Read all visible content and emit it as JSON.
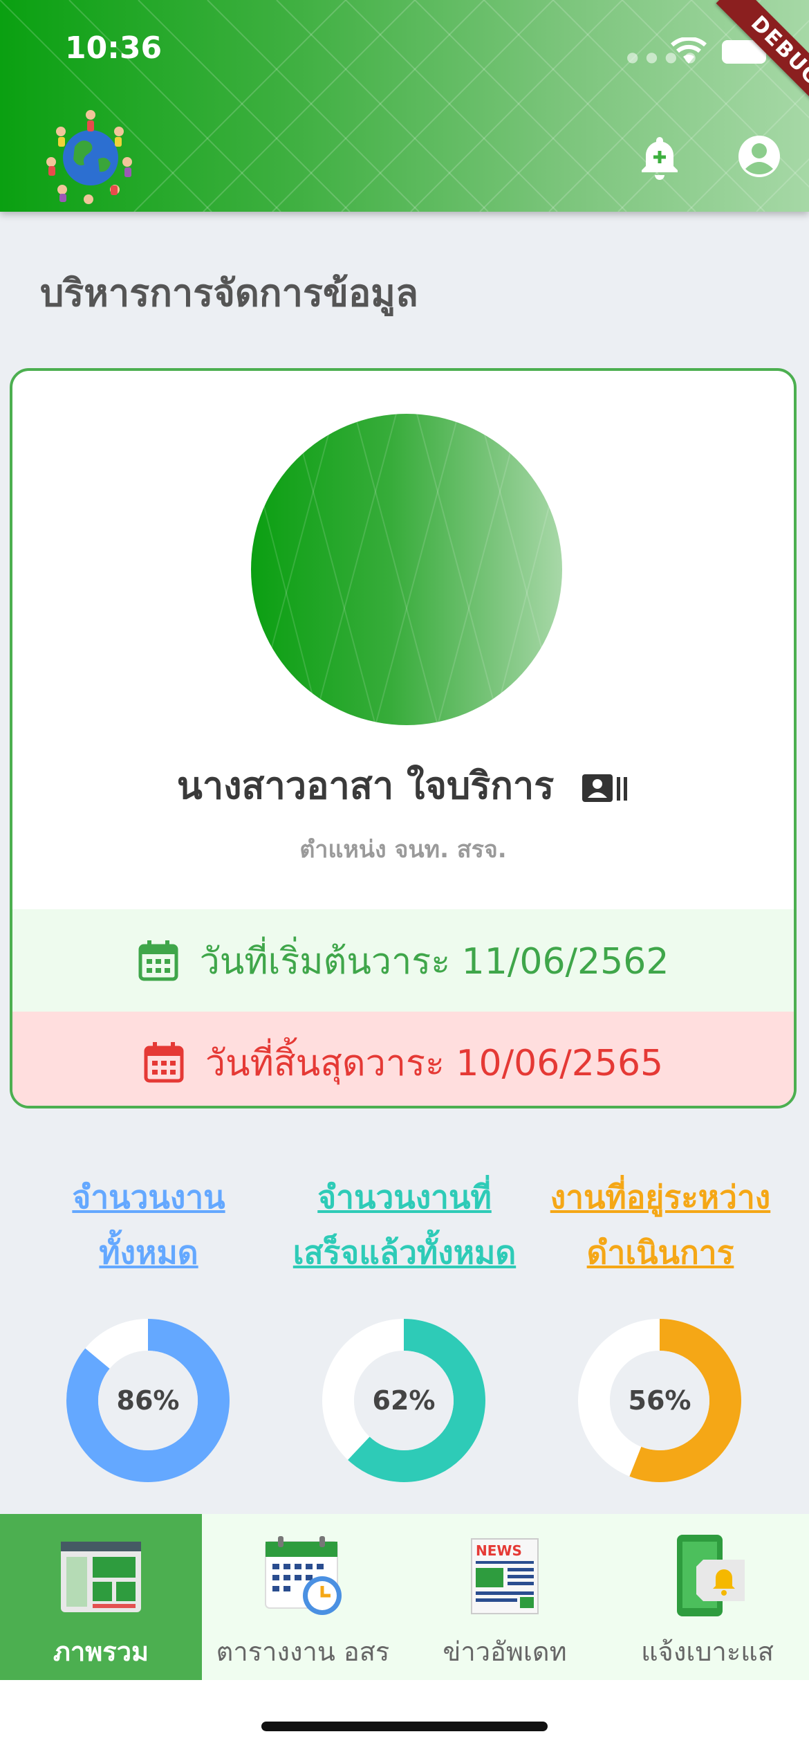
{
  "status_bar": {
    "time": "10:36",
    "debug_label": "DEBUG"
  },
  "header": {
    "logo_icon": "kids-around-globe-logo",
    "notification_icon": "bell-plus-icon",
    "profile_icon": "account-circle-icon",
    "gradient": [
      "#0aa011",
      "#a6d8a6"
    ]
  },
  "page": {
    "title": "บริหารการจัดการข้อมูล"
  },
  "profile": {
    "name": "นางสาวอาสา ใจบริการ",
    "id_icon": "id-card-icon",
    "position": "ตำแหน่ง จนท. สรจ.",
    "term_start": "วันที่เริ่มต้นวาระ 11/06/2562",
    "term_end": "วันที่สิ้นสุดวาระ 10/06/2565",
    "start_color": "#3fa64a",
    "end_color": "#e53935"
  },
  "stats": [
    {
      "label_line1": "จำนวนงาน",
      "label_line2": "ทั้งหมด",
      "percent": 86,
      "percent_text": "86%",
      "color": "#64a8ff"
    },
    {
      "label_line1": "จำนวนงานที่",
      "label_line2": "เสร็จแล้วทั้งหมด",
      "percent": 62,
      "percent_text": "62%",
      "color": "#2ecbb7"
    },
    {
      "label_line1": "งานที่อยู่ระหว่าง",
      "label_line2": "ดำเนินการ",
      "percent": 56,
      "percent_text": "56%",
      "color": "#f5a716"
    }
  ],
  "bottom_nav": [
    {
      "label": "ภาพรวม",
      "icon": "dashboard-overview-icon",
      "active": true
    },
    {
      "label": "ตารางงาน อสร",
      "icon": "calendar-clock-icon",
      "active": false
    },
    {
      "label": "ข่าวอัพเดท",
      "icon": "news-paper-icon",
      "active": false
    },
    {
      "label": "แจ้งเบาะแส",
      "icon": "phone-bell-icon",
      "active": false
    }
  ]
}
